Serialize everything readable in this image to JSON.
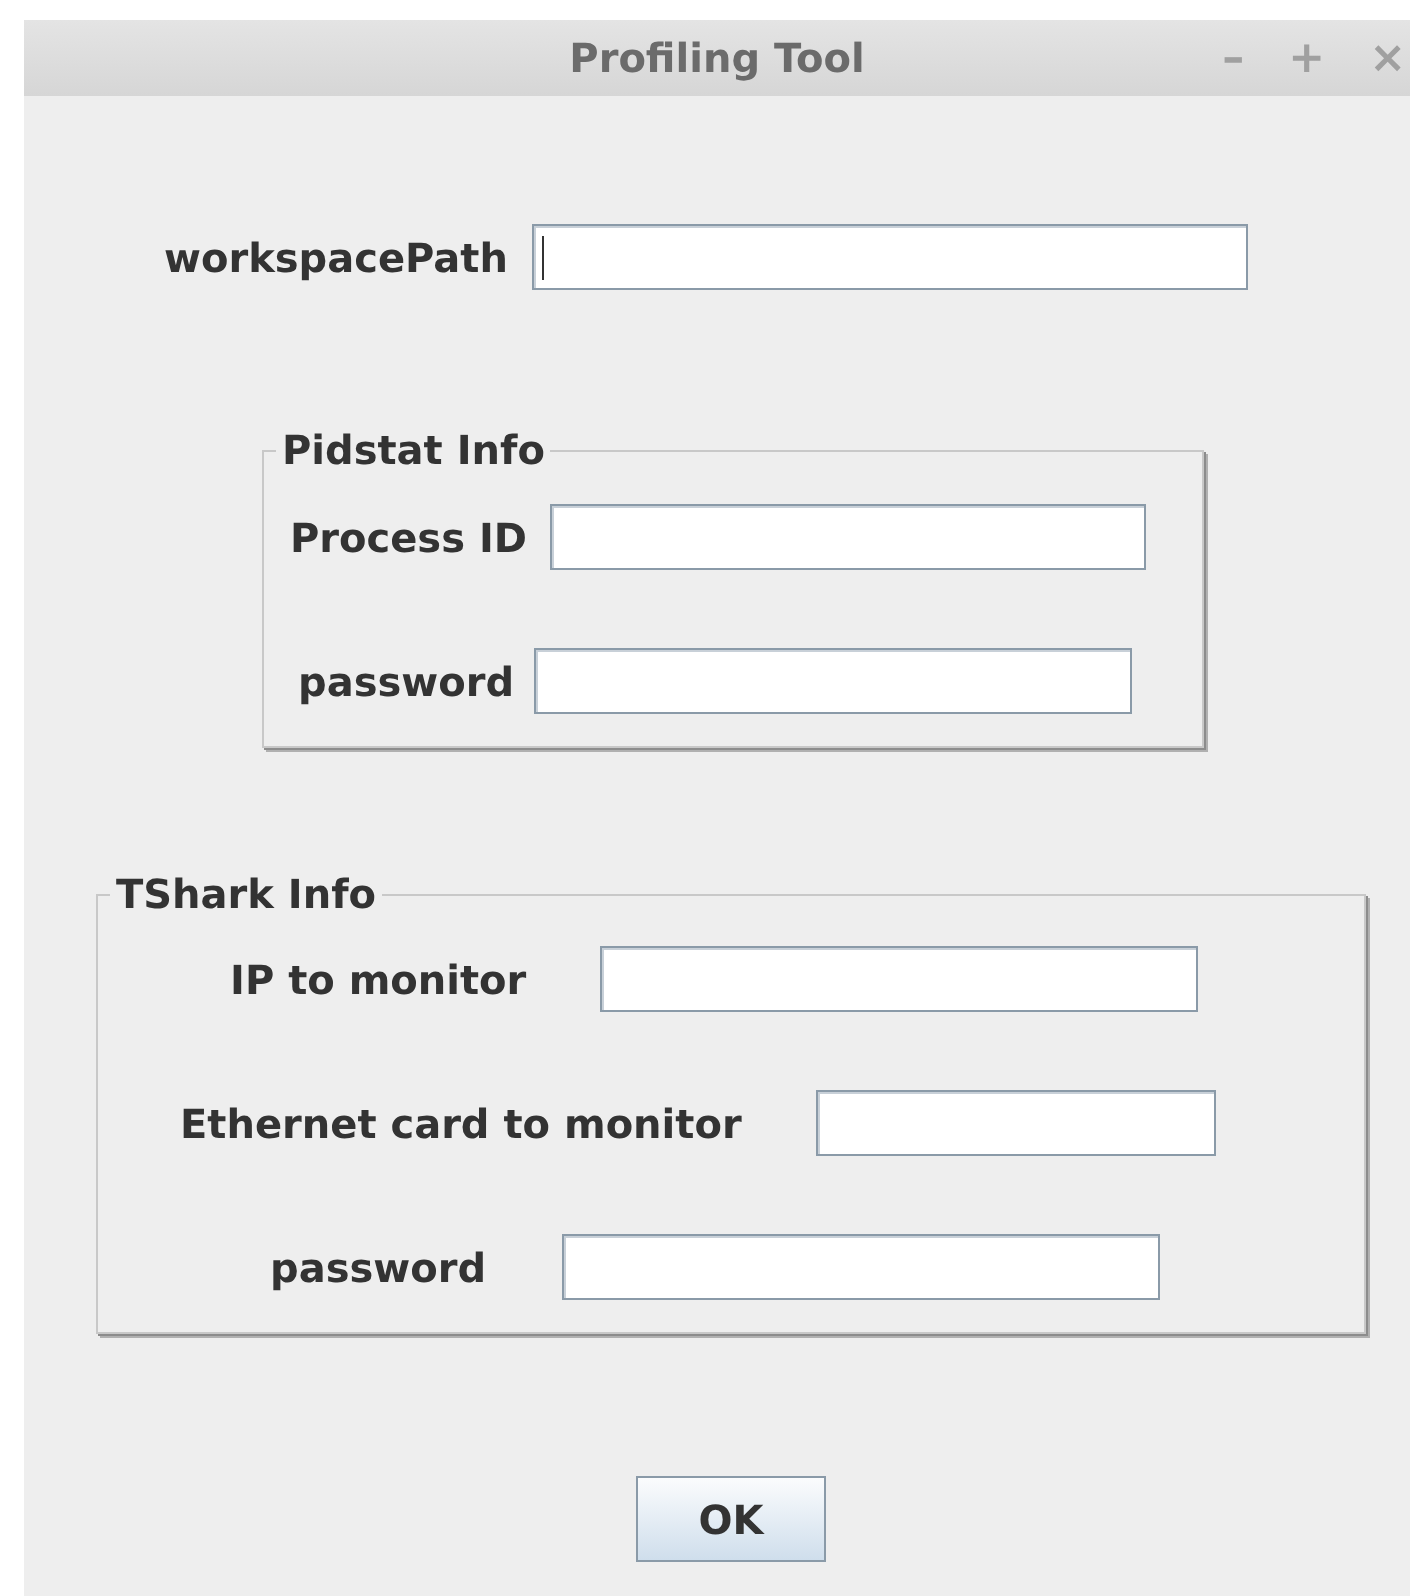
{
  "window": {
    "title": "Profiling Tool",
    "controls": [
      "–",
      "+",
      "×"
    ]
  },
  "workspace": {
    "label": "workspacePath",
    "focused": true
  },
  "groups": [
    {
      "title": "Pidstat Info",
      "fields": [
        {
          "label": "Process ID",
          "focused": false
        },
        {
          "label": "password",
          "focused": false
        }
      ]
    },
    {
      "title": "TShark Info",
      "fields": [
        {
          "label": "IP to monitor",
          "focused": false
        },
        {
          "label": "Ethernet card to monitor",
          "focused": false
        },
        {
          "label": "password",
          "focused": false
        }
      ]
    }
  ],
  "buttons": [
    "OK"
  ]
}
